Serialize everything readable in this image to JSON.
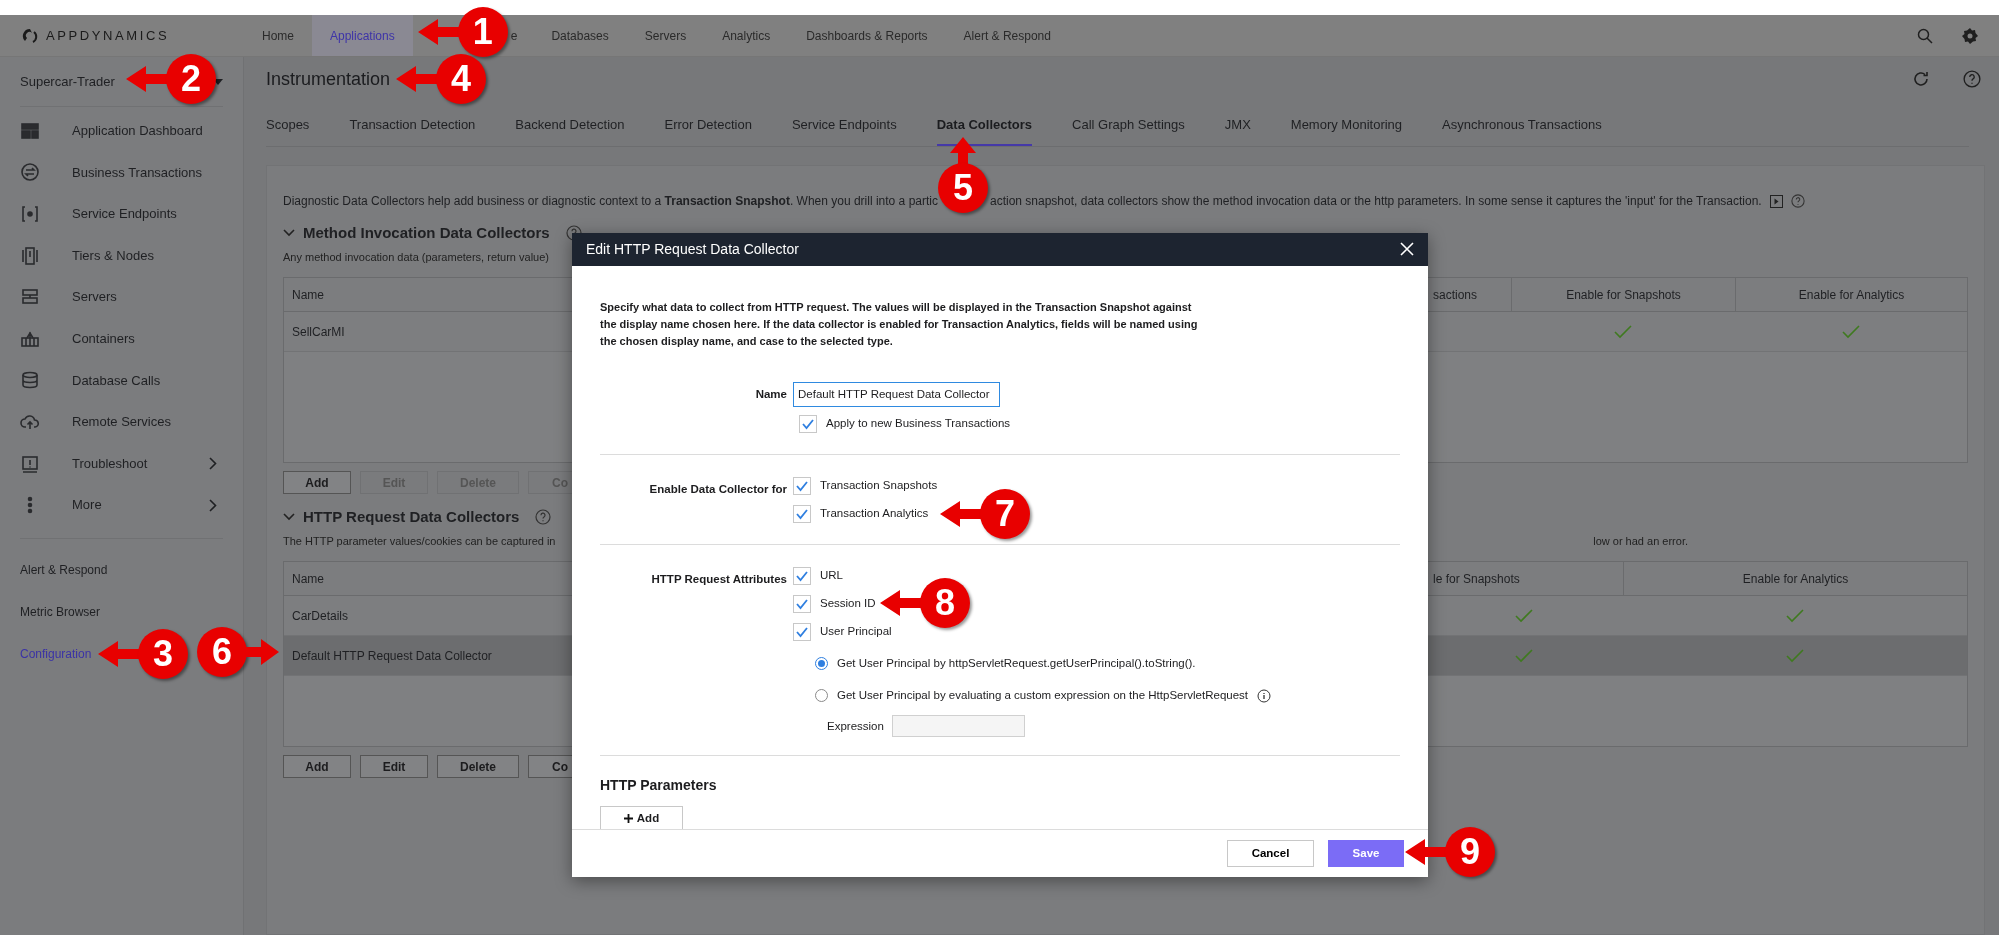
{
  "top_nav": {
    "logo": "APPDYNAMICS",
    "items": [
      {
        "label": "Home",
        "selected": false
      },
      {
        "label": "Applications",
        "selected": true
      },
      {
        "label": "e",
        "selected": false
      },
      {
        "label": "Databases",
        "selected": false
      },
      {
        "label": "Servers",
        "selected": false
      },
      {
        "label": "Analytics",
        "selected": false
      },
      {
        "label": "Dashboards & Reports",
        "selected": false
      },
      {
        "label": "Alert & Respond",
        "selected": false
      }
    ]
  },
  "sidebar": {
    "app_name": "Supercar-Trader",
    "items": [
      {
        "label": "Application Dashboard",
        "submenu": false
      },
      {
        "label": "Business Transactions",
        "submenu": false
      },
      {
        "label": "Service Endpoints",
        "submenu": false
      },
      {
        "label": "Tiers & Nodes",
        "submenu": false
      },
      {
        "label": "Servers",
        "submenu": false
      },
      {
        "label": "Containers",
        "submenu": false
      },
      {
        "label": "Database Calls",
        "submenu": false
      },
      {
        "label": "Remote Services",
        "submenu": false
      },
      {
        "label": "Troubleshoot",
        "submenu": true
      },
      {
        "label": "More",
        "submenu": true
      }
    ],
    "links": [
      {
        "label": "Alert & Respond",
        "selected": false
      },
      {
        "label": "Metric Browser",
        "selected": false
      },
      {
        "label": "Configuration",
        "selected": true
      }
    ]
  },
  "page": {
    "title": "Instrumentation",
    "tabs": [
      {
        "label": "Scopes",
        "selected": false
      },
      {
        "label": "Transaction Detection",
        "selected": false
      },
      {
        "label": "Backend Detection",
        "selected": false
      },
      {
        "label": "Error Detection",
        "selected": false
      },
      {
        "label": "Service Endpoints",
        "selected": false
      },
      {
        "label": "Data Collectors",
        "selected": true
      },
      {
        "label": "Call Graph Settings",
        "selected": false
      },
      {
        "label": "JMX",
        "selected": false
      },
      {
        "label": "Memory Monitoring",
        "selected": false
      },
      {
        "label": "Asynchronous Transactions",
        "selected": false
      }
    ],
    "intro": "Diagnostic Data Collectors help add business or diagnostic context to a **Transaction Snapshot**. When you drill into a partic",
    "intro_continued": "action snapshot, data collectors show the method invocation data or the http parameters. In some sense it captures the 'input' for the Transaction.",
    "sections": [
      {
        "title": "Method Invocation Data Collectors",
        "description": "Any method invocation data (parameters, return value)",
        "columns": [
          "Name",
          "sactions",
          "Enable for Snapshots",
          "Enable for Analytics"
        ],
        "rows": [
          {
            "name": "SellCarMI",
            "selected": false,
            "snapshots": true,
            "analytics": true
          }
        ],
        "buttons": [
          {
            "label": "Add",
            "disabled": false
          },
          {
            "label": "Edit",
            "disabled": true
          },
          {
            "label": "Delete",
            "disabled": true
          },
          {
            "label": "Co",
            "disabled": true
          }
        ]
      },
      {
        "title": "HTTP Request Data Collectors",
        "description": "The HTTP parameter values/cookies can be captured in",
        "description_right": "low or had an error.",
        "columns": [
          "Name",
          "",
          "le for Snapshots",
          "Enable for Analytics"
        ],
        "rows": [
          {
            "name": "CarDetails",
            "selected": false,
            "snapshots": true,
            "analytics": true
          },
          {
            "name": "Default HTTP Request Data Collector",
            "selected": true,
            "snapshots": true,
            "analytics": true
          }
        ],
        "buttons": [
          {
            "label": "Add",
            "disabled": false
          },
          {
            "label": "Edit",
            "disabled": false
          },
          {
            "label": "Delete",
            "disabled": false
          },
          {
            "label": "Co",
            "disabled": false
          }
        ]
      }
    ]
  },
  "dialog": {
    "title": "Edit HTTP Request Data Collector",
    "intro": "Specify what data to collect from HTTP request. The values will be displayed in the Transaction Snapshot against the display name chosen here. If the data collector is enabled for Transaction Analytics, fields will be named using the chosen display name, and case to the selected type.",
    "name_label": "Name",
    "name_value": "Default HTTP Request Data Collector",
    "apply": {
      "label": "Apply to new Business Transactions",
      "checked": true
    },
    "enable_label": "Enable Data Collector for",
    "enable": [
      {
        "label": "Transaction Snapshots",
        "checked": true
      },
      {
        "label": "Transaction Analytics",
        "checked": true
      }
    ],
    "attributes_label": "HTTP Request Attributes",
    "attributes": [
      {
        "label": "URL",
        "checked": true
      },
      {
        "label": "Session ID",
        "checked": true
      },
      {
        "label": "User Principal",
        "checked": true
      }
    ],
    "principal_options": [
      {
        "label": "Get User Principal by httpServletRequest.getUserPrincipal().toString().",
        "selected": true,
        "info": false
      },
      {
        "label": "Get User Principal by evaluating a custom expression on the HttpServletRequest",
        "selected": false,
        "info": true
      }
    ],
    "expression_label": "Expression",
    "parameters_title": "HTTP Parameters",
    "add_button": "Add",
    "cancel": "Cancel",
    "save": "Save"
  },
  "callouts": [
    {
      "number": "1"
    },
    {
      "number": "2"
    },
    {
      "number": "3"
    },
    {
      "number": "4"
    },
    {
      "number": "5"
    },
    {
      "number": "6"
    },
    {
      "number": "7"
    },
    {
      "number": "8"
    },
    {
      "number": "9"
    }
  ]
}
